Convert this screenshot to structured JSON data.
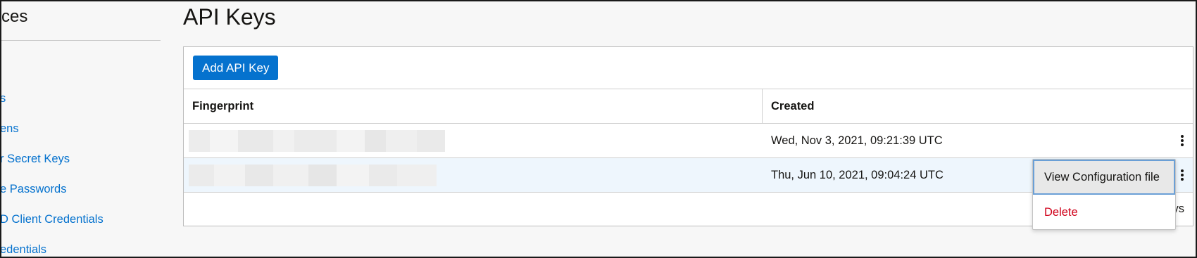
{
  "sidebar": {
    "title": "ces",
    "items": [
      {
        "label": "s"
      },
      {
        "label": "ens"
      },
      {
        "label": "r Secret Keys"
      },
      {
        "label": "e Passwords"
      },
      {
        "label": "D Client Credentials"
      },
      {
        "label": "edentials"
      }
    ]
  },
  "page": {
    "title": "API Keys"
  },
  "panel": {
    "add_button_label": "Add API Key",
    "columns": {
      "fingerprint": "Fingerprint",
      "created": "Created"
    },
    "rows": [
      {
        "created": "Wed, Nov 3, 2021, 09:21:39 UTC"
      },
      {
        "created": "Thu, Jun 10, 2021, 09:04:24 UTC"
      }
    ],
    "footer_partial": "ys"
  },
  "row_menu": {
    "items": [
      {
        "label": "View Configuration file"
      },
      {
        "label": "Delete"
      }
    ]
  },
  "colors": {
    "primary": "#0572ce",
    "danger": "#d0021b",
    "link": "#0572ce"
  },
  "icons": {
    "row_actions": "kebab-vertical-icon"
  }
}
